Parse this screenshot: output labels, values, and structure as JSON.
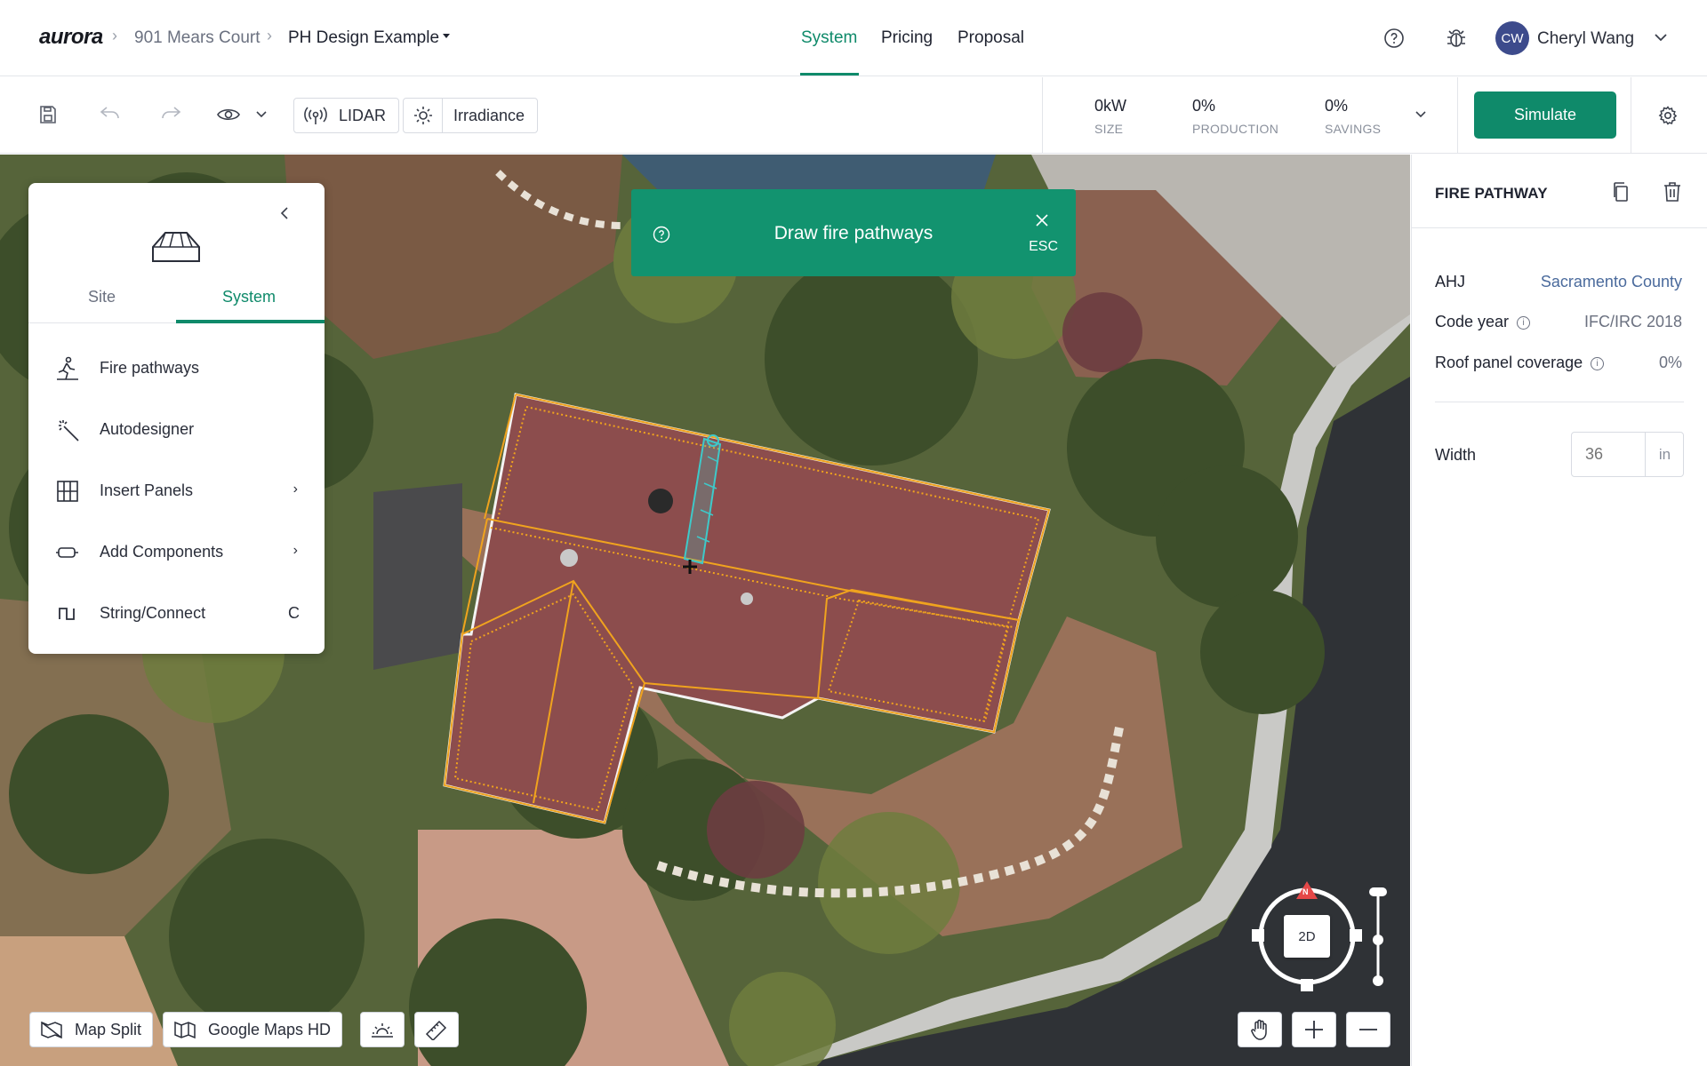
{
  "app": {
    "logo": "aurora"
  },
  "breadcrumb": {
    "project": "901 Mears Court",
    "design": "PH  Design Example"
  },
  "nav": {
    "tabs": [
      "System",
      "Pricing",
      "Proposal"
    ],
    "active": "System"
  },
  "user": {
    "initials": "CW",
    "name": "Cheryl Wang"
  },
  "toolbar": {
    "lidar_label": "LIDAR",
    "irradiance_label": "Irradiance",
    "stats": [
      {
        "value": "0kW",
        "label": "SIZE"
      },
      {
        "value": "0%",
        "label": "PRODUCTION"
      },
      {
        "value": "0%",
        "label": "SAVINGS"
      }
    ],
    "simulate_label": "Simulate"
  },
  "left_panel": {
    "tabs": [
      "Site",
      "System"
    ],
    "active_tab": "System",
    "items": [
      {
        "label": "Fire pathways",
        "icon": "fire-pathway-icon",
        "chevron": false,
        "shortcut": ""
      },
      {
        "label": "Autodesigner",
        "icon": "magic-wand-icon",
        "chevron": false,
        "shortcut": ""
      },
      {
        "label": "Insert Panels",
        "icon": "panel-grid-icon",
        "chevron": true,
        "shortcut": ""
      },
      {
        "label": "Add Components",
        "icon": "component-icon",
        "chevron": true,
        "shortcut": ""
      },
      {
        "label": "String/Connect",
        "icon": "string-icon",
        "chevron": false,
        "shortcut": "C"
      }
    ]
  },
  "banner": {
    "text": "Draw fire pathways",
    "close_hint": "ESC"
  },
  "right_panel": {
    "title": "FIRE PATHWAY",
    "ahj_label": "AHJ",
    "ahj_value": "Sacramento County",
    "code_year_label": "Code year",
    "code_year_value": "IFC/IRC 2018",
    "coverage_label": "Roof panel coverage",
    "coverage_value": "0%",
    "width_label": "Width",
    "width_placeholder": "36",
    "width_unit": "in"
  },
  "map_controls": {
    "map_split_label": "Map Split",
    "google_maps_label": "Google Maps HD",
    "view_mode": "2D",
    "compass_north": "N"
  },
  "colors": {
    "accent": "#0f8a6a",
    "roof_outline": "#f0a31e",
    "pathway": "#3ec9c9"
  }
}
